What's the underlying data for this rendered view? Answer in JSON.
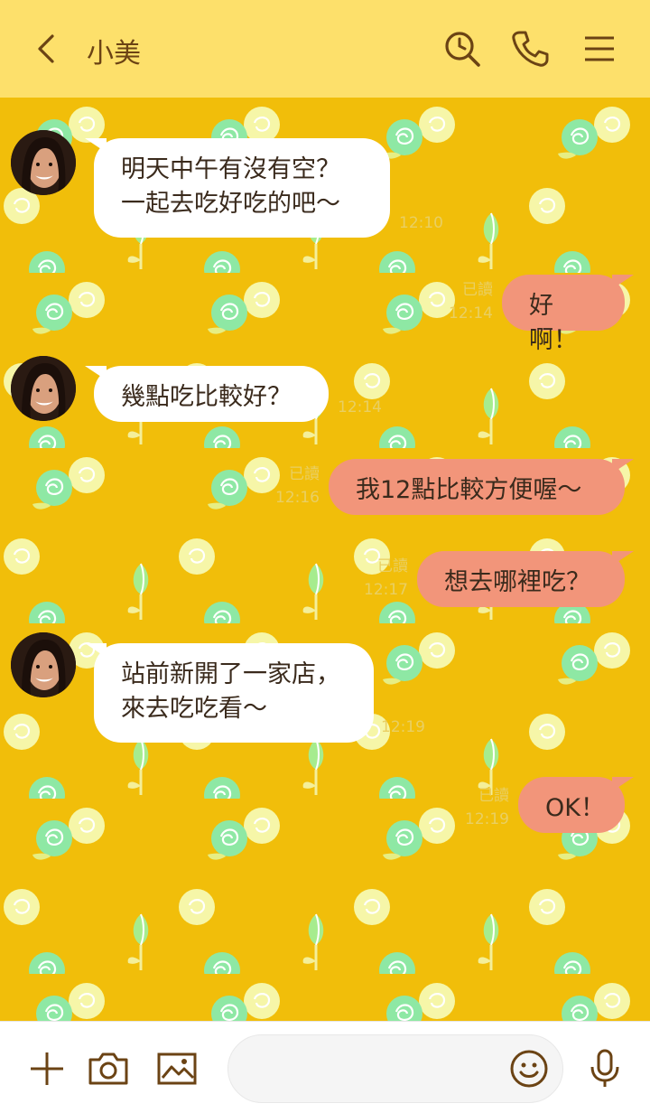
{
  "header": {
    "contact_name": "小美",
    "icons": [
      "back-icon",
      "search-icon",
      "phone-icon",
      "menu-icon"
    ]
  },
  "messages": [
    {
      "side": "in",
      "text": "明天中午有沒有空？\n一起去吃好吃的吧～",
      "time": "12:10"
    },
    {
      "side": "out",
      "text": "好啊！",
      "read": "已讀",
      "time": "12:14"
    },
    {
      "side": "in",
      "text": "幾點吃比較好？",
      "time": "12:14"
    },
    {
      "side": "out",
      "text": "我12點比較方便喔～",
      "read": "已讀",
      "time": "12:16"
    },
    {
      "side": "out",
      "text": "想去哪裡吃？",
      "read": "已讀",
      "time": "12:17"
    },
    {
      "side": "in",
      "text": "站前新開了一家店，\n來去吃吃看～",
      "time": "12:19"
    },
    {
      "side": "out",
      "text": "OK！",
      "read": "已讀",
      "time": "12:19"
    }
  ],
  "footer": {
    "input_placeholder": "",
    "icons": [
      "plus-icon",
      "camera-icon",
      "image-icon",
      "emoji-icon",
      "microphone-icon"
    ]
  },
  "colors": {
    "header_bg": "#fde06b",
    "chat_bg": "#f1be0a",
    "incoming_bubble": "#ffffff",
    "outgoing_bubble": "#f2957a",
    "icon_brown": "#6b4314"
  }
}
